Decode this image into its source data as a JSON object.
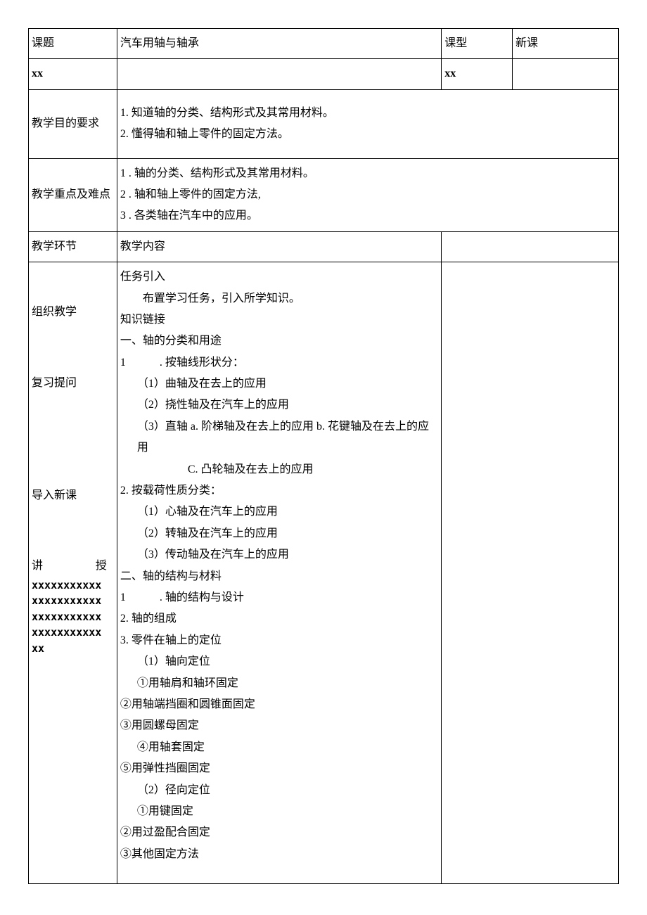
{
  "row1": {
    "label_topic": "课题",
    "topic": "汽车用轴与轴承",
    "label_type": "课型",
    "type": "新课"
  },
  "row2": {
    "left": "xx",
    "mid": "",
    "right_label": "xx",
    "right_val": ""
  },
  "objectives": {
    "label": "教学目的要求",
    "line1": "1. 知道轴的分类、结构形式及其常用材料。",
    "line2": "2. 懂得轴和轴上零件的固定方法。"
  },
  "keypoints": {
    "label": "教学重点及难点",
    "line1": "1 . 轴的分类、结构形式及其常用材料。",
    "line2": "2 . 轴和轴上零件的固定方法,",
    "line3": "3 . 各类轴在汽车中的应用。"
  },
  "stage_header": {
    "left": "教学环节",
    "right": "教学内容"
  },
  "stages": {
    "s1": "组织教学",
    "s2": "复习提问",
    "s3": "导入新课",
    "lecture_a": "讲",
    "lecture_b": "授",
    "x1": "xxxxxxxxxxx",
    "x2": "xxxxxxxxxxx",
    "x3": "xxxxxxxxxxx",
    "x4": "xxxxxxxxxxx",
    "x5": "xx"
  },
  "content": {
    "task_intro_title": "任务引入",
    "task_intro_body": "布置学习任务，引入所学知识。",
    "knowledge_link": "知识链接",
    "sec1_title": "一、轴的分类和用途",
    "sec1_1_num": "1",
    "sec1_1_text": ". 按轴线形状分：",
    "sec1_1_1": "（1）曲轴及在去上的应用",
    "sec1_1_2": "（2）挠性轴及在汽车上的应用",
    "sec1_1_3": "（3）直轴 a. 阶梯轴及在去上的应用 b. 花键轴及在去上的应用",
    "sec1_1_3c": "C. 凸轮轴及在去上的应用",
    "sec1_2_title": "2. 按载荷性质分类：",
    "sec1_2_1": "（1）心轴及在汽车上的应用",
    "sec1_2_2": "（2）转轴及在汽车上的应用",
    "sec1_2_3": "（3）传动轴及在汽车上的应用",
    "sec2_title": "二、轴的结构与材料",
    "sec2_1_num": "1",
    "sec2_1_text": ". 轴的结构与设计",
    "sec2_2": "2. 轴的组成",
    "sec2_3": "3. 零件在轴上的定位",
    "sec2_3_1": "（1）轴向定位",
    "sec2_3_1_1": "①用轴肩和轴环固定",
    "sec2_3_1_2": "②用轴端挡圈和圆锥面固定",
    "sec2_3_1_3": "③用圆螺母固定",
    "sec2_3_1_4": "④用轴套固定",
    "sec2_3_1_5": "⑤用弹性挡圈固定",
    "sec2_3_2": "（2）径向定位",
    "sec2_3_2_1": "①用键固定",
    "sec2_3_2_2": "②用过盈配合固定",
    "sec2_3_2_3": "③其他固定方法"
  }
}
